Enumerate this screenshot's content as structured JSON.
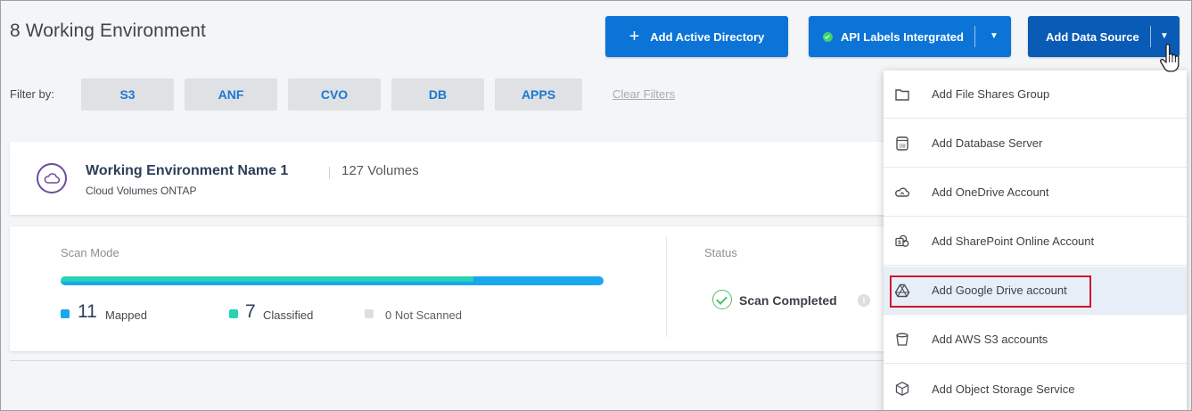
{
  "page": {
    "title": "8 Working Environment"
  },
  "toolbar": {
    "add_active_directory": "Add Active Directory",
    "api_labels": "API Labels Intergrated",
    "add_data_source": "Add Data Source"
  },
  "filters": {
    "label": "Filter by:",
    "chips": [
      "S3",
      "ANF",
      "CVO",
      "DB",
      "APPS"
    ],
    "clear": "Clear Filters"
  },
  "environment": {
    "name": "Working Environment Name 1",
    "volumes": "127 Volumes",
    "type": "Cloud Volumes ONTAP"
  },
  "scan": {
    "label": "Scan Mode",
    "progress": {
      "mapped_fraction": 0.76
    },
    "mapped_count": "11",
    "mapped_label": "Mapped",
    "classified_count": "7",
    "classified_label": "Classified",
    "not_scanned": "0 Not Scanned",
    "colors": {
      "mapped": "#19a7ee",
      "classified": "#27d3b4",
      "not_scanned": "#dcdfe2"
    }
  },
  "status": {
    "label": "Status",
    "text": "Scan Completed"
  },
  "menu": {
    "items": [
      {
        "label": "Add File Shares Group",
        "icon": "folder-icon"
      },
      {
        "label": "Add Database Server",
        "icon": "database-icon"
      },
      {
        "label": "Add OneDrive Account",
        "icon": "onedrive-icon"
      },
      {
        "label": "Add SharePoint Online Account",
        "icon": "sharepoint-icon"
      },
      {
        "label": "Add Google Drive account",
        "icon": "google-drive-icon",
        "highlighted": true
      },
      {
        "label": "Add AWS S3 accounts",
        "icon": "bucket-icon"
      },
      {
        "label": "Add Object Storage Service",
        "icon": "cube-icon"
      }
    ]
  },
  "theme": {
    "primary": "#0b74d6",
    "primary_dark": "#0a5bb5",
    "highlight_border": "#d0162b",
    "success": "#4fbf67"
  }
}
